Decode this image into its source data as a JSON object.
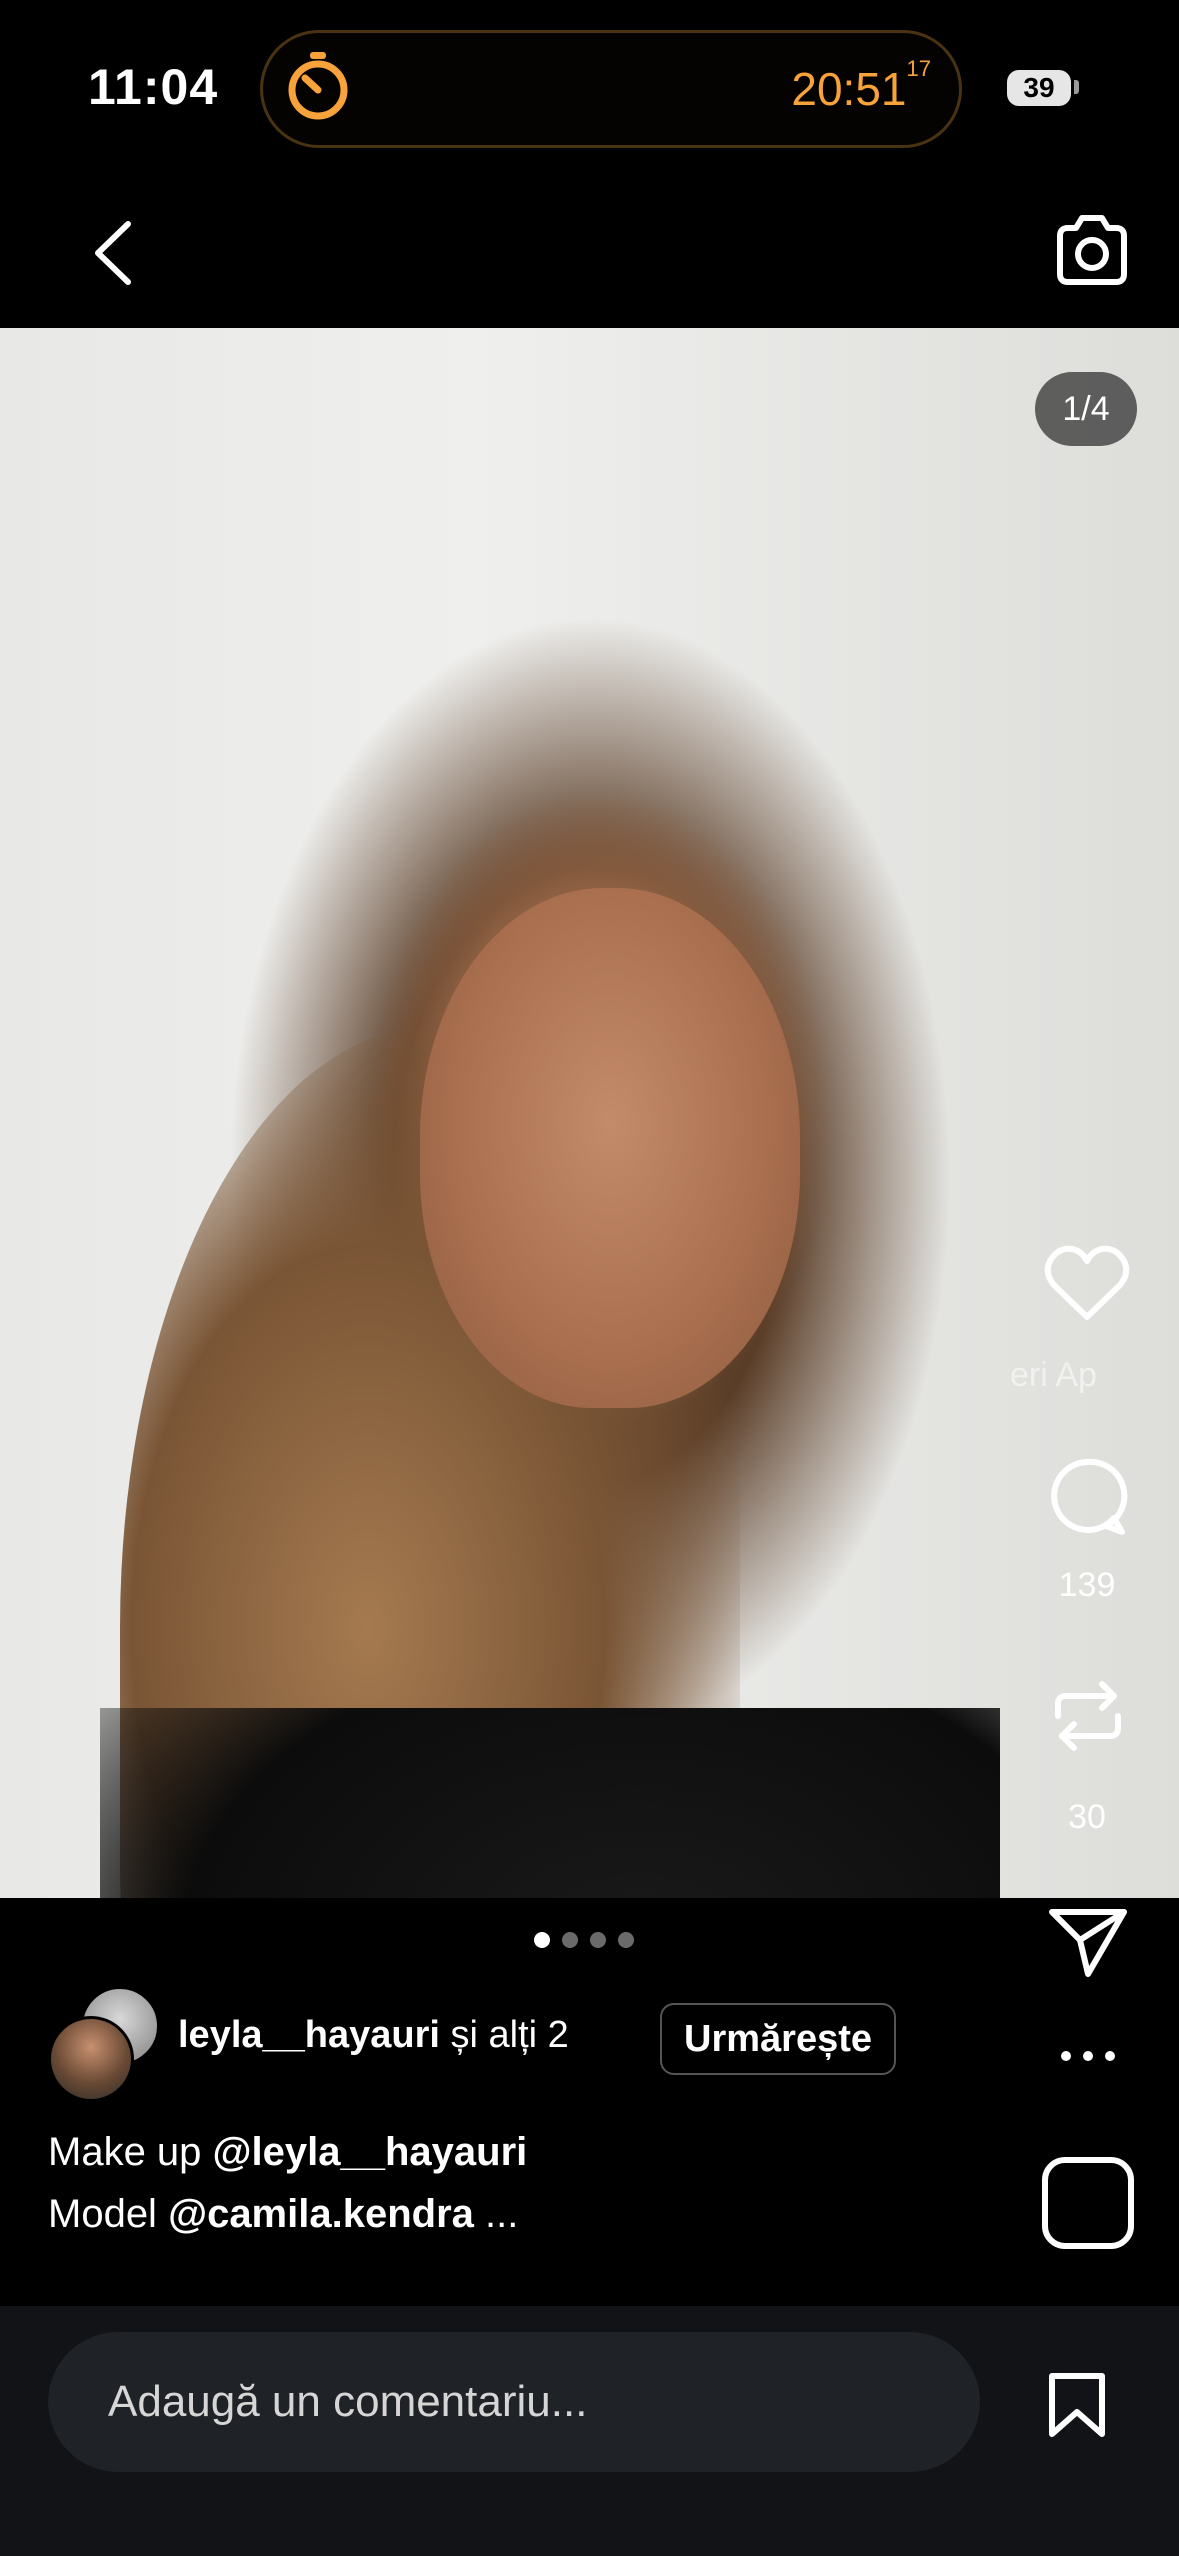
{
  "status_bar": {
    "time": "11:04",
    "timer": {
      "time": "20:51",
      "fraction": "17"
    },
    "battery": "39"
  },
  "colors": {
    "accent_timer": "#f7a23a",
    "background": "#000000",
    "comment_bar": "#111316"
  },
  "nav": {
    "back_icon": "chevron-left-icon",
    "camera_icon": "camera-icon"
  },
  "media": {
    "counter": "1/4",
    "dots": {
      "total": 4,
      "active_index": 0
    }
  },
  "actions": {
    "like_icon": "heart-icon",
    "translation_snippet": "eri   Ap",
    "comment_count": "139",
    "repost_count": "30",
    "share_icon": "paper-plane-icon",
    "more_icon": "ellipsis-icon"
  },
  "author": {
    "name": "leyla__hayauri",
    "others": "și alți 2",
    "follow_label": "Urmărește"
  },
  "caption": {
    "line1_prefix": "Make up ",
    "line1_mention": "@leyla__hayauri",
    "line2_prefix": "Model ",
    "line2_mention": "@camila.kendra",
    "more": " ..."
  },
  "comment": {
    "placeholder": "Adaugă un comentariu..."
  }
}
